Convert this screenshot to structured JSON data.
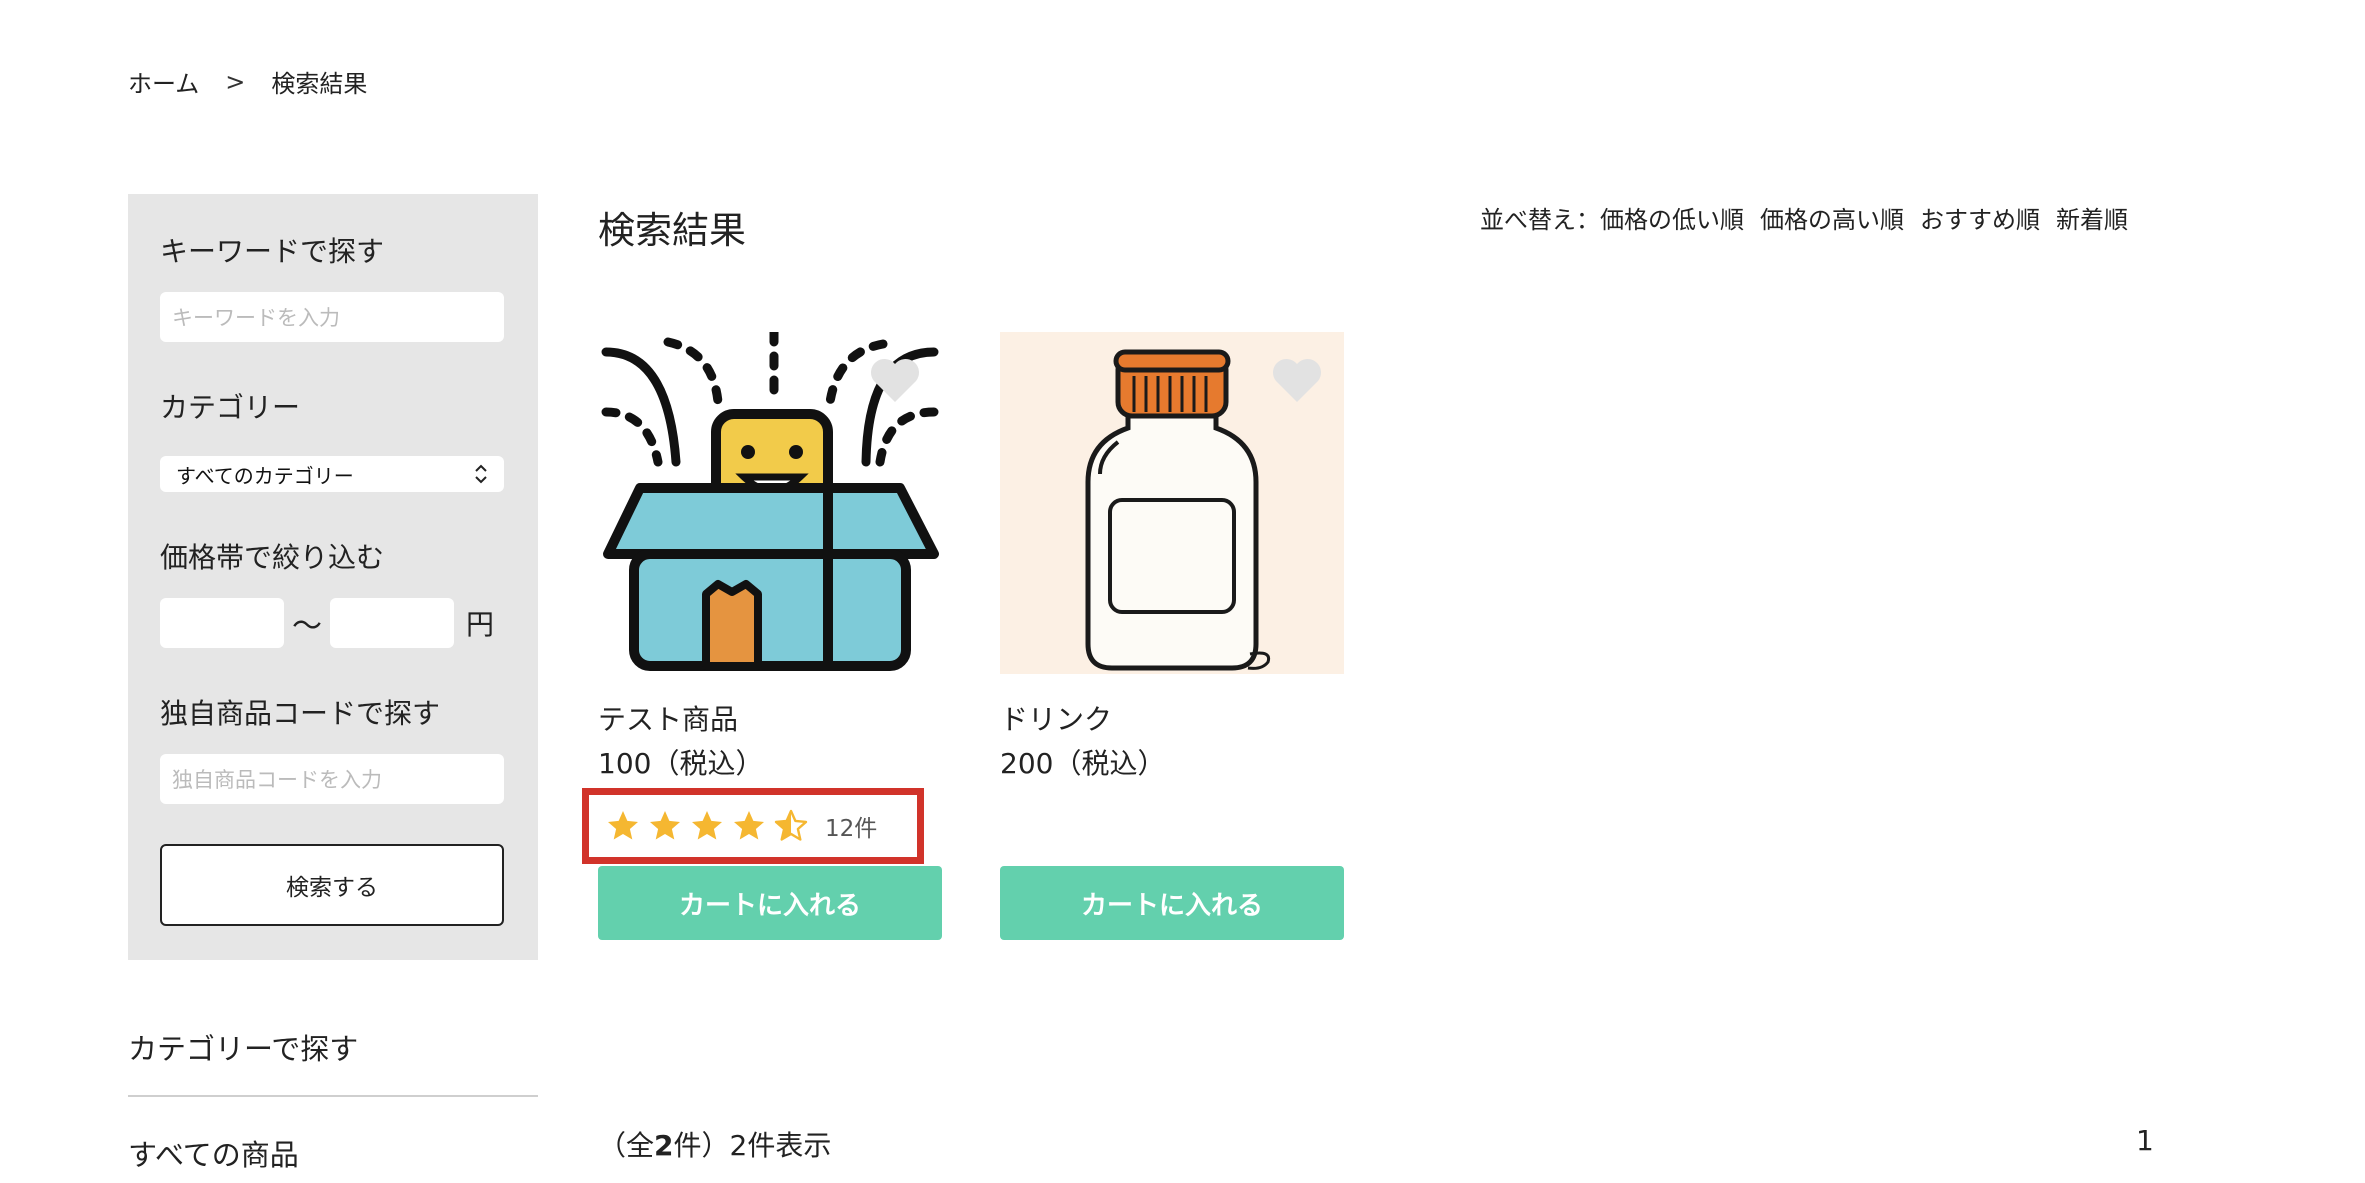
{
  "breadcrumb": {
    "home": "ホーム",
    "separator": ">",
    "current": "検索結果"
  },
  "sidebar": {
    "keyword_label": "キーワードで探す",
    "keyword_placeholder": "キーワードを入力",
    "category_label": "カテゴリー",
    "category_selected": "すべてのカテゴリー",
    "price_label": "価格帯で絞り込む",
    "price_separator": "〜",
    "price_unit": "円",
    "code_label": "独自商品コードで探す",
    "code_placeholder": "独自商品コードを入力",
    "search_button": "検索する",
    "category_nav_title": "カテゴリーで探す",
    "category_nav_all": "すべての商品"
  },
  "main": {
    "title": "検索結果",
    "sort": {
      "prefix": "並べ替え：",
      "options": [
        "価格の低い順",
        "価格の高い順",
        "おすすめ順",
        "新着順"
      ]
    },
    "products": [
      {
        "name": "テスト商品",
        "price": "100（税込）",
        "rating": 4.5,
        "review_count": "12件",
        "cart_label": "カートに入れる",
        "image_icon": "gift-box-icon"
      },
      {
        "name": "ドリンク",
        "price": "200（税込）",
        "cart_label": "カートに入れる",
        "image_icon": "bottle-icon"
      }
    ],
    "result_summary": {
      "prefix": "（全",
      "total": "2",
      "suffix": "件）2件表示"
    },
    "pager_current": "1"
  },
  "colors": {
    "accent_cart": "#63d0ad",
    "highlight_border": "#d1332a",
    "star": "#f5b731",
    "sidebar_bg": "#e6e6e6"
  }
}
